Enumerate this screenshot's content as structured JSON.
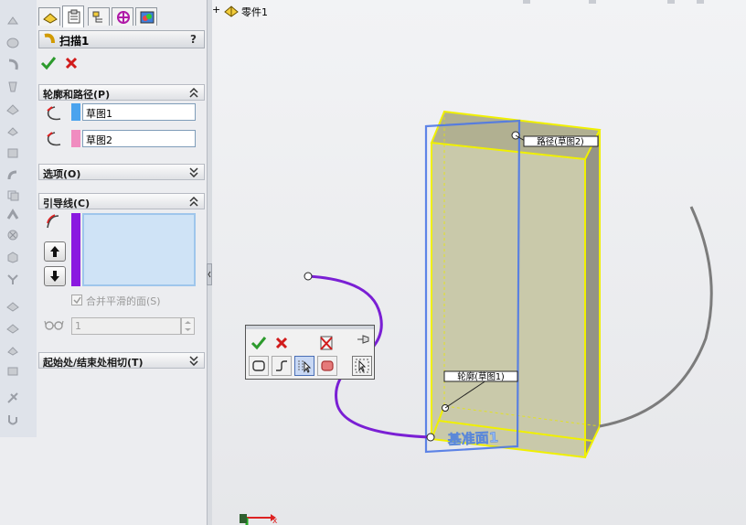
{
  "feature": {
    "title": "扫描1",
    "help": "?"
  },
  "groups": {
    "profile_path": {
      "label": "轮廓和路径(P)",
      "profile_value": "草图1",
      "path_value": "草图2"
    },
    "options": {
      "label": "选项(O)"
    },
    "guides": {
      "label": "引导线(C)",
      "merge_label": "合并平滑的面(S)",
      "spin_value": "1"
    },
    "tangency": {
      "label": "起始处/结束处相切(T)"
    }
  },
  "tree": {
    "root": "零件1",
    "expand": "+"
  },
  "callouts": {
    "path": "路径(草图2)",
    "profile": "轮廓(草图1)"
  },
  "plane_label": "基准面1",
  "triad": {
    "x_label": "x"
  },
  "colors": {
    "profile_swatch": "#4aa3ee",
    "path_swatch": "#f08cc0",
    "guide_swatch": "#8a19e0",
    "guide_curve": "#7a1fd4",
    "selection_blue": "#4e78e6",
    "highlight_yellow": "#f0f000"
  },
  "icons": [
    "tab-feature-manager-icon",
    "tab-property-manager-icon",
    "tab-configuration-icon",
    "tab-dimxpert-icon",
    "tab-display-icon",
    "ok-check-icon",
    "cancel-x-icon",
    "profile-selector-icon",
    "path-selector-icon",
    "guide-selector-icon",
    "move-up-icon",
    "move-down-icon",
    "glasses-icon"
  ]
}
